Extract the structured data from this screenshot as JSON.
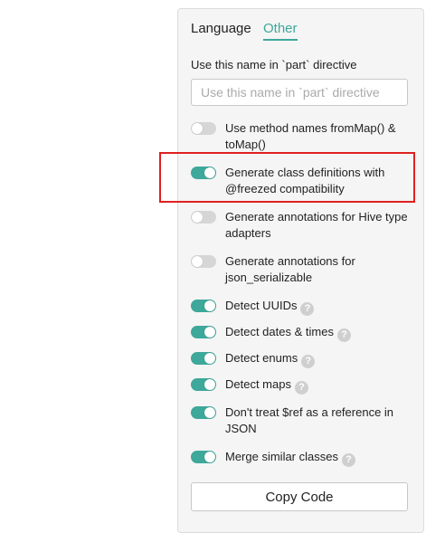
{
  "tabs": [
    {
      "label": "Language"
    },
    {
      "label": "Other"
    }
  ],
  "active_tab": "Other",
  "name_field": {
    "label": "Use this name in `part` directive",
    "placeholder": "Use this name in `part` directive",
    "value": ""
  },
  "options": [
    {
      "label": "Use method names fromMap() & toMap()",
      "enabled": false,
      "help": false
    },
    {
      "label": "Generate class definitions with @freezed compatibility",
      "enabled": true,
      "help": false
    },
    {
      "label": "Generate annotations for Hive type adapters",
      "enabled": false,
      "help": false
    },
    {
      "label": "Generate annotations for json_serializable",
      "enabled": false,
      "help": false
    },
    {
      "label": "Detect UUIDs",
      "enabled": true,
      "help": true
    },
    {
      "label": "Detect dates & times",
      "enabled": true,
      "help": true
    },
    {
      "label": "Detect enums",
      "enabled": true,
      "help": true
    },
    {
      "label": "Detect maps",
      "enabled": true,
      "help": true
    },
    {
      "label": "Don't treat $ref as a reference in JSON",
      "enabled": true,
      "help": false
    },
    {
      "label": "Merge similar classes",
      "enabled": true,
      "help": true
    }
  ],
  "help_glyph": "?",
  "copy_button": {
    "label": "Copy Code"
  },
  "colors": {
    "accent": "#3ea89a",
    "toggle_off": "#d6d6d6",
    "highlight": "#e02020"
  },
  "icons": {
    "help": "question-circle-icon"
  }
}
